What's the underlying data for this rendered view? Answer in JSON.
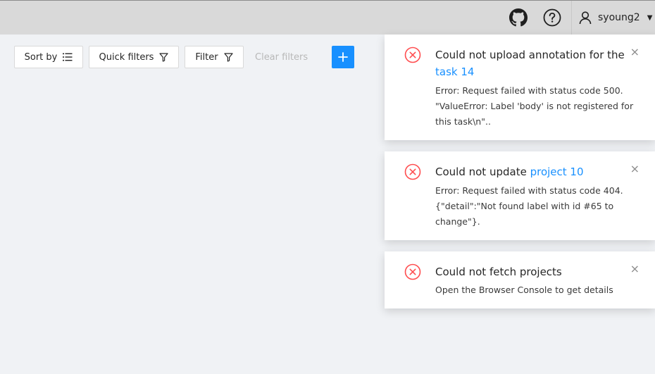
{
  "header": {
    "github_icon": "github-icon",
    "help_icon": "question-circle-icon",
    "user": {
      "name": "syoung2",
      "icon": "user-icon",
      "caret": "▼"
    }
  },
  "toolbar": {
    "sort_label": "Sort by",
    "quick_filters_label": "Quick filters",
    "filter_label": "Filter",
    "clear_filters_label": "Clear filters",
    "add_label": "+"
  },
  "notifications": [
    {
      "title_prefix": "Could not upload annotation for the",
      "title_link": "task 14",
      "description": "Error: Request failed with status code 500. \"ValueError: Label 'body' is not registered for this task\\n\".."
    },
    {
      "title_prefix": "Could not update",
      "title_link": "project 10",
      "description": "Error: Request failed with status code 404. {\"detail\":\"Not found label with id #65 to change\"}."
    },
    {
      "title_prefix": "Could not fetch projects",
      "title_link": "",
      "description": "Open the Browser Console to get details"
    }
  ],
  "colors": {
    "accent": "#1890ff",
    "error": "#ff4d4f",
    "header_bg": "#d9d9d9",
    "page_bg": "#f0f2f5"
  },
  "close_glyph": "×"
}
